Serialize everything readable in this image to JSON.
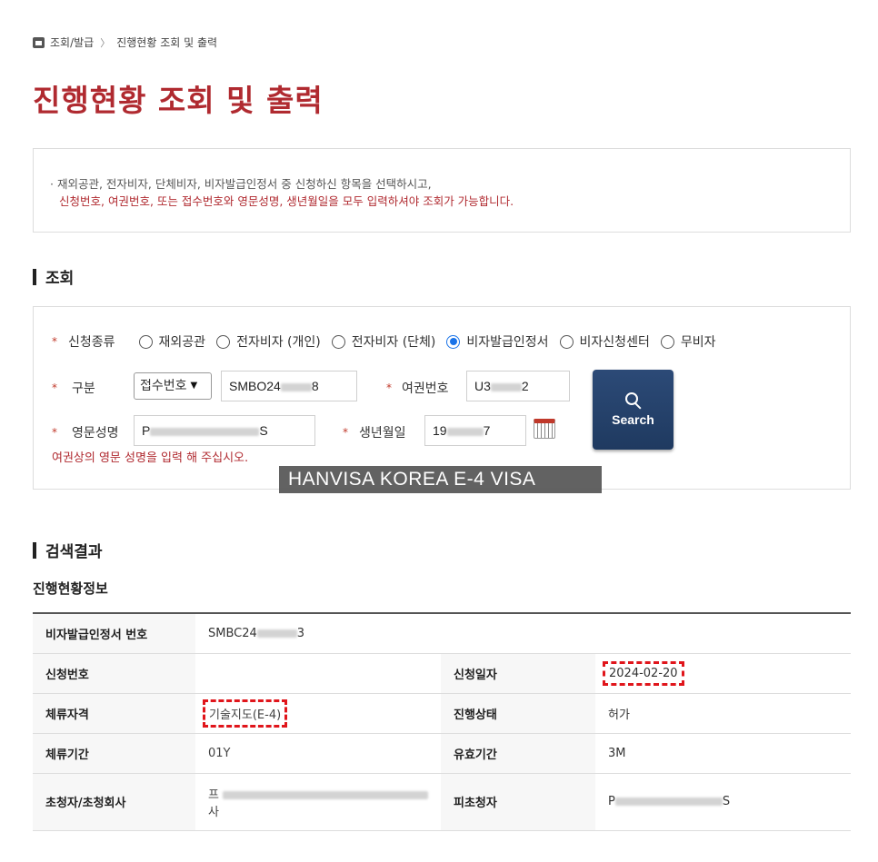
{
  "breadcrumb": {
    "item1": "조회/발급",
    "sep": "〉",
    "item2": "진행현황 조회 및 출력"
  },
  "page_title": "진행현황 조회 및 출력",
  "notice": {
    "line1": "· 재외공관, 전자비자, 단체비자, 비자발급인정서 중 신청하신 항목을 선택하시고,",
    "line2": "신청번호, 여권번호, 또는 접수번호와 영문성명, 생년월일을 모두 입력하셔야 조회가 가능합니다."
  },
  "section_search": "조회",
  "form": {
    "required_mark": "*",
    "type_label": "신청종류",
    "radio_options": [
      "재외공관",
      "전자비자 (개인)",
      "전자비자 (단체)",
      "비자발급인정서",
      "비자신청센터",
      "무비자"
    ],
    "radio_selected_index": 3,
    "category_label": "구분",
    "category_select": "접수번호",
    "receipt_no": {
      "prefix": "SMBO24",
      "suffix": "8"
    },
    "passport_label": "여권번호",
    "passport_no": {
      "prefix": "U3",
      "suffix": "2"
    },
    "name_label": "영문성명",
    "name_value": {
      "prefix": "P",
      "suffix": "S"
    },
    "birth_label": "생년월일",
    "birth_value": {
      "prefix": "19",
      "suffix": "7"
    },
    "search_button": "Search",
    "hint": "여권상의 영문 성명을 입력 해 주십시오.",
    "watermark": "HANVISA KOREA E-4 VISA"
  },
  "section_result": "검색결과",
  "result_subtitle": "진행현황정보",
  "result": {
    "cert_no_label": "비자발급인정서 번호",
    "cert_no": {
      "prefix": "SMBC24",
      "suffix": "3"
    },
    "apply_no_label": "신청번호",
    "apply_no": "",
    "apply_date_label": "신청일자",
    "apply_date": "2024-02-20",
    "status_label_left": "체류자격",
    "status_value": "기술지도(E-4)",
    "progress_label": "진행상태",
    "progress_value": "허가",
    "stay_period_label": "체류기간",
    "stay_period": "01Y",
    "validity_label": "유효기간",
    "validity": "3M",
    "inviter_label": "초청자/초청회사",
    "inviter": {
      "first": "프",
      "second": "사"
    },
    "invitee_label": "피초청자",
    "invitee": {
      "prefix": "P",
      "suffix": "S"
    }
  },
  "colors": {
    "accent_red": "#b02a30",
    "button_navy": "#1f3a60",
    "radio_blue": "#1a73e8",
    "highlight_dash": "#e0151b"
  }
}
